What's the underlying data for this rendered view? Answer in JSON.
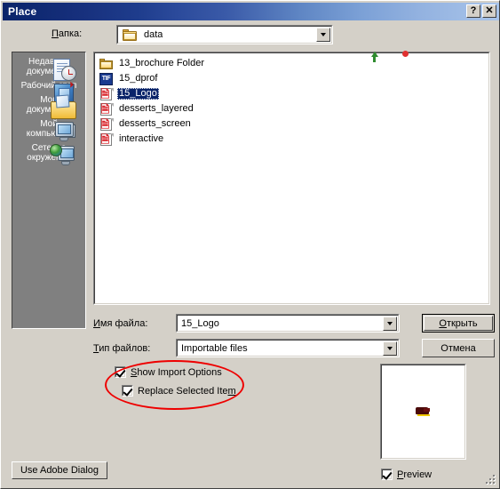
{
  "window": {
    "title": "Place",
    "help_button": "?",
    "close_button": "✕"
  },
  "lookin": {
    "label_prefix": "",
    "label_accel": "П",
    "label_rest": "апка:",
    "label_full": "Папка:",
    "value": "data",
    "folder_icon": "folder-icon"
  },
  "toolbar": {
    "back": "back-icon",
    "up": "up-one-level-icon",
    "new_folder": "new-folder-icon",
    "views": "views-icon"
  },
  "places": {
    "items": [
      {
        "label_line1": "Недавние",
        "label_line2": "документы",
        "icon": "recent-documents-icon"
      },
      {
        "label_line1": "Рабочий стол",
        "label_line2": "",
        "icon": "desktop-icon"
      },
      {
        "label_line1": "Мои",
        "label_line2": "документы",
        "icon": "my-documents-icon"
      },
      {
        "label_line1": "Мой",
        "label_line2": "компьютер",
        "icon": "my-computer-icon"
      },
      {
        "label_line1": "Сетевое",
        "label_line2": "окружение",
        "icon": "network-places-icon"
      }
    ]
  },
  "files": [
    {
      "name": "13_brochure Folder",
      "icon": "folder-icon",
      "type": "folder",
      "selected": false
    },
    {
      "name": "15_dprof",
      "icon": "tif-file-icon",
      "type": "tif",
      "badge": "TIF",
      "selected": false
    },
    {
      "name": "15_Logo",
      "icon": "pdf-file-icon",
      "type": "pdf",
      "selected": true
    },
    {
      "name": "desserts_layered",
      "icon": "pdf-file-icon",
      "type": "pdf",
      "selected": false
    },
    {
      "name": "desserts_screen",
      "icon": "pdf-file-icon",
      "type": "pdf",
      "selected": false
    },
    {
      "name": "interactive",
      "icon": "pdf-file-icon",
      "type": "pdf",
      "selected": false
    }
  ],
  "form": {
    "filename_label": "Имя файла:",
    "filename_accel": "И",
    "filename_rest": "мя файла:",
    "filename_value": "15_Logo",
    "filetype_label": "Тип файлов:",
    "filetype_accel": "Т",
    "filetype_rest": "ип файлов:",
    "filetype_value": "Importable files"
  },
  "buttons": {
    "open_accel": "О",
    "open_rest": "ткрыть",
    "open": "Открыть",
    "cancel": "Отмена",
    "use_adobe_dialog": "Use Adobe Dialog"
  },
  "options": {
    "show_import_options": {
      "label_accel": "S",
      "label_rest": "how Import Options",
      "label": "Show Import Options",
      "checked": true
    },
    "replace_selected_item": {
      "label_accel": "m",
      "label_pre": "Replace Selected Ite",
      "label": "Replace Selected Item",
      "checked": true
    },
    "preview": {
      "label_accel": "P",
      "label_rest": "review",
      "label": "Preview",
      "checked": true
    }
  },
  "annotation": {
    "shape": "ellipse",
    "color": "#ee0000",
    "targets": "Show Import Options, Replace Selected Item"
  },
  "colors": {
    "dialog_face": "#d4d0c8",
    "title_start": "#0a246a",
    "title_end": "#a8c4ea",
    "selection": "#0a246a",
    "places_bar": "#808080",
    "annotation_red": "#ee0000"
  }
}
